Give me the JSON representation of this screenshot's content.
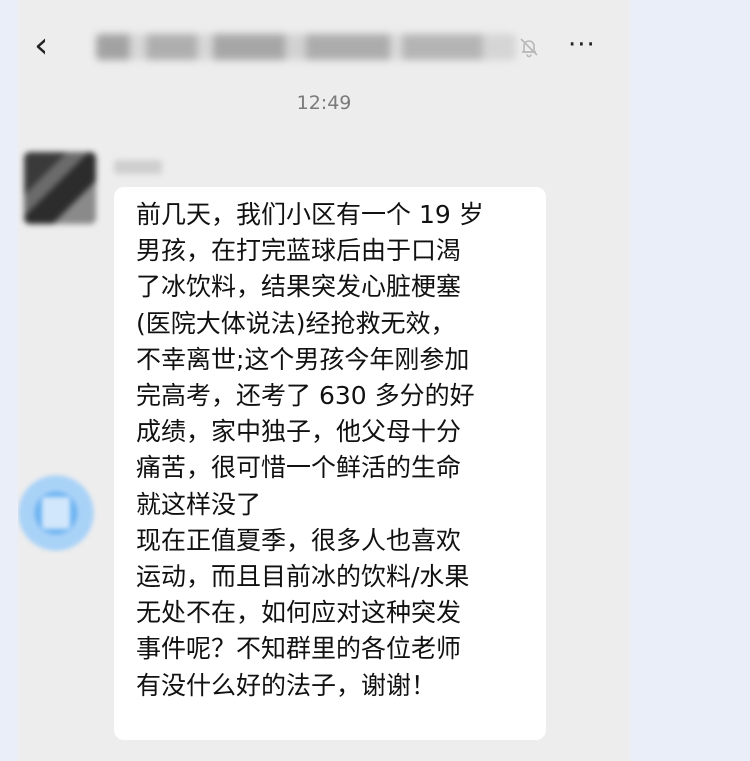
{
  "header": {
    "back_icon": "chevron-left-icon",
    "title": "",
    "mute_icon": "bell-off-icon",
    "more_icon": "more-dots-icon",
    "more_label": "···"
  },
  "timestamp": "12:49",
  "message": {
    "text": "前几天，我们小区有一个 19 岁\n男孩，在打完蓝球后由于口渴\n了冰饮料，结果突发心脏梗塞\n(医院大体说法)经抢救无效，\n不幸离世;这个男孩今年刚参加\n完高考，还考了 630 多分的好\n成绩，家中独子，他父母十分\n痛苦，很可惜一个鲜活的生命\n就这样没了\n现在正值夏季，很多人也喜欢\n运动，而且目前冰的饮料/水果\n无处不在，如何应对这种突发\n事件呢？不知群里的各位老师\n有没什么好的法子，谢谢！"
  }
}
